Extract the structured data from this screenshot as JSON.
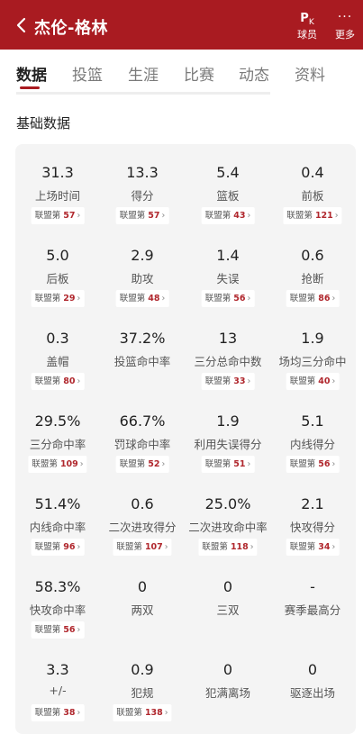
{
  "header": {
    "back_icon": "chevron-left-icon",
    "title": "杰伦-格林",
    "pk_glyph": "P",
    "pk_glyph_sub": "K",
    "pk_label": "球员",
    "more_glyph": "···",
    "more_label": "更多",
    "color": "#a91b21"
  },
  "tabs": [
    "数据",
    "投篮",
    "生涯",
    "比赛",
    "动态",
    "资料"
  ],
  "active_tab": "数据",
  "section_title": "基础数据",
  "rank_prefix": "联盟第",
  "rank_chevron": "›",
  "stats": [
    {
      "value": "31.3",
      "label": "上场时间",
      "rank": "57"
    },
    {
      "value": "13.3",
      "label": "得分",
      "rank": "57"
    },
    {
      "value": "5.4",
      "label": "篮板",
      "rank": "43"
    },
    {
      "value": "0.4",
      "label": "前板",
      "rank": "121"
    },
    {
      "value": "5.0",
      "label": "后板",
      "rank": "29"
    },
    {
      "value": "2.9",
      "label": "助攻",
      "rank": "48"
    },
    {
      "value": "1.4",
      "label": "失误",
      "rank": "56"
    },
    {
      "value": "0.6",
      "label": "抢断",
      "rank": "86"
    },
    {
      "value": "0.3",
      "label": "盖帽",
      "rank": "80"
    },
    {
      "value": "37.2%",
      "label": "投篮命中率",
      "rank": null
    },
    {
      "value": "13",
      "label": "三分总命中数",
      "rank": "33"
    },
    {
      "value": "1.9",
      "label": "场均三分命中",
      "rank": "40"
    },
    {
      "value": "29.5%",
      "label": "三分命中率",
      "rank": "109"
    },
    {
      "value": "66.7%",
      "label": "罚球命中率",
      "rank": "52"
    },
    {
      "value": "1.9",
      "label": "利用失误得分",
      "rank": "51"
    },
    {
      "value": "5.1",
      "label": "内线得分",
      "rank": "56"
    },
    {
      "value": "51.4%",
      "label": "内线命中率",
      "rank": "96"
    },
    {
      "value": "0.6",
      "label": "二次进攻得分",
      "rank": "107"
    },
    {
      "value": "25.0%",
      "label": "二次进攻命中率",
      "rank": "118"
    },
    {
      "value": "2.1",
      "label": "快攻得分",
      "rank": "34"
    },
    {
      "value": "58.3%",
      "label": "快攻命中率",
      "rank": "56"
    },
    {
      "value": "0",
      "label": "两双",
      "rank": null
    },
    {
      "value": "0",
      "label": "三双",
      "rank": null
    },
    {
      "value": "-",
      "label": "赛季最高分",
      "rank": null
    },
    {
      "value": "3.3",
      "label": "+/-",
      "rank": "38"
    },
    {
      "value": "0.9",
      "label": "犯规",
      "rank": "138"
    },
    {
      "value": "0",
      "label": "犯满离场",
      "rank": null
    },
    {
      "value": "0",
      "label": "驱逐出场",
      "rank": null
    }
  ]
}
